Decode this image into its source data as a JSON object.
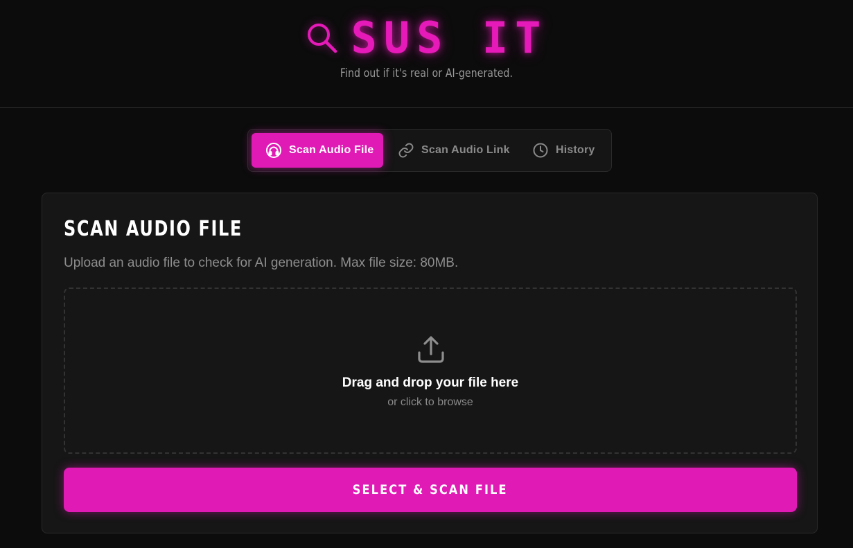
{
  "app": {
    "title": "SUS IT",
    "tagline": "Find out if it's real or AI-generated."
  },
  "tabs": [
    {
      "label": "Scan Audio File",
      "icon": "headphones-icon",
      "active": true
    },
    {
      "label": "Scan Audio Link",
      "icon": "link-icon",
      "active": false
    },
    {
      "label": "History",
      "icon": "clock-icon",
      "active": false
    }
  ],
  "card": {
    "title": "SCAN AUDIO FILE",
    "description": "Upload an audio file to check for AI generation. Max file size: 80MB.",
    "dropzone": {
      "icon": "upload-icon",
      "title": "Drag and drop your file here",
      "subtitle": "or click to browse"
    },
    "button_label": "SELECT & SCAN FILE"
  },
  "colors": {
    "accent": "#e01ab5",
    "background": "#0c0c0c",
    "card": "#161616"
  }
}
